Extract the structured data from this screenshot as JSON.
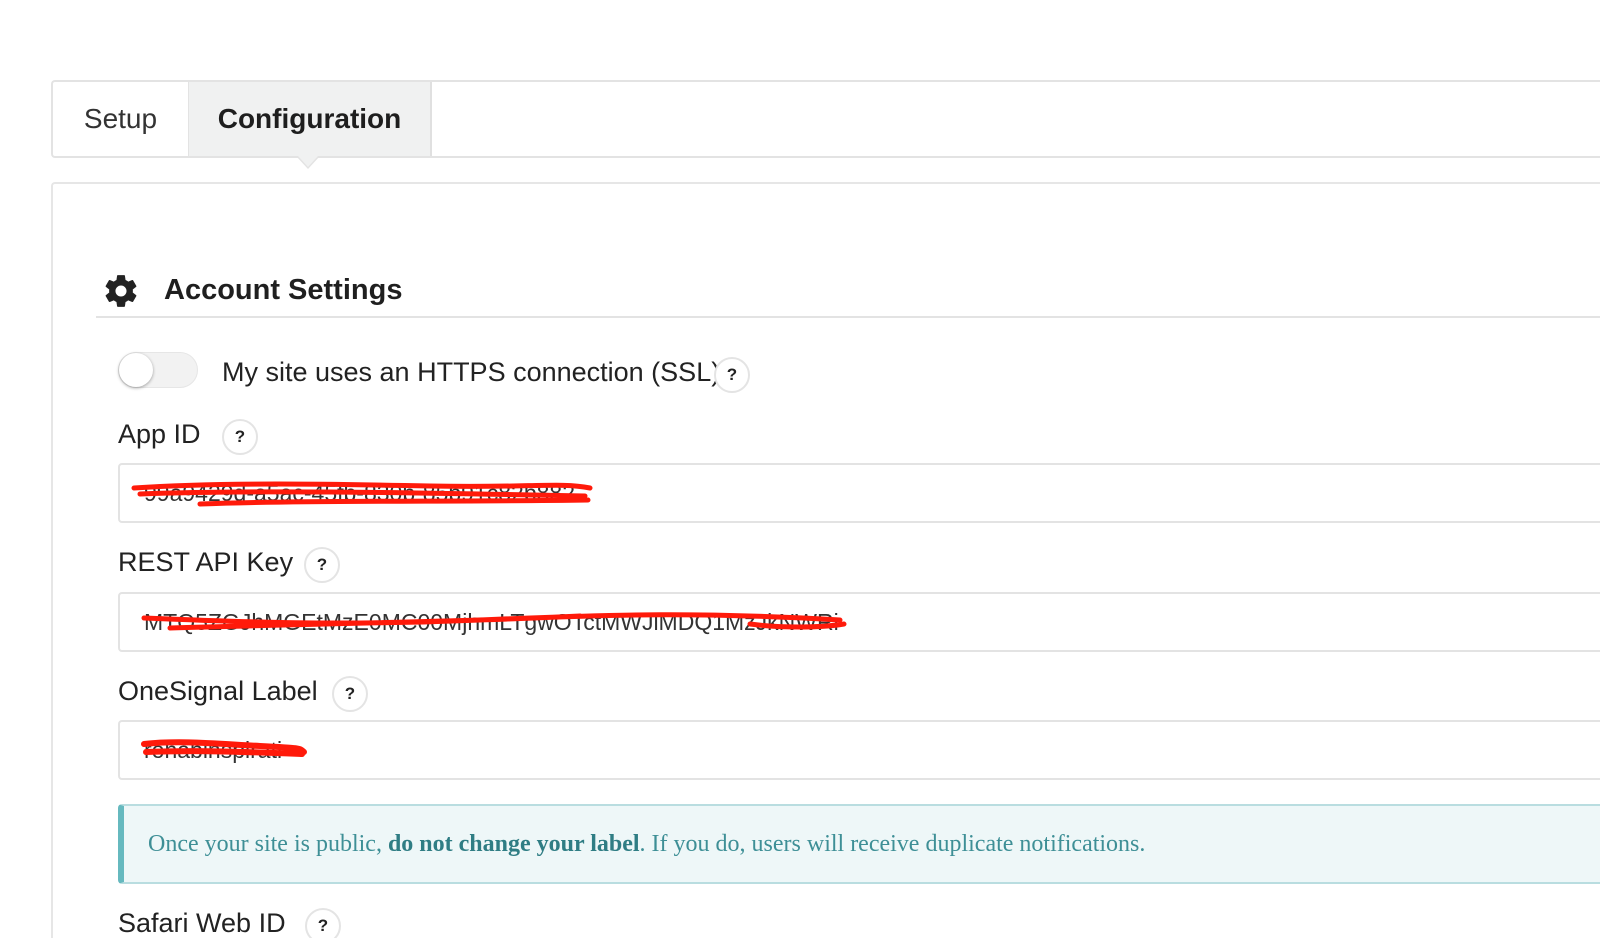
{
  "tabs": [
    {
      "label": "Setup",
      "active": false
    },
    {
      "label": "Configuration",
      "active": true
    }
  ],
  "section": {
    "title": "Account Settings",
    "icon": "gear-icon"
  },
  "https_toggle": {
    "label": "My site uses an HTTPS connection (SSL)",
    "enabled": false,
    "help": "?"
  },
  "fields": {
    "app_id": {
      "label": "App ID",
      "help": "?",
      "value": "99a9429d-a5ac-45fb-830b-85b91c82b882"
    },
    "rest_api_key": {
      "label": "REST API Key",
      "help": "?",
      "value": "MTQ5ZGJhMGEtMzE0MC00MjhmLTgwOTctMWJlMDQ1MzJkNWRi"
    },
    "onesignal_label": {
      "label": "OneSignal Label",
      "help": "?",
      "value": "rohabinspirati"
    }
  },
  "notice": {
    "prefix": "Once your site is public, ",
    "bold": "do not change your label",
    "suffix": ". If you do, users will receive duplicate notifications."
  },
  "next_field": {
    "label": "Safari Web ID",
    "help": "?"
  },
  "colors": {
    "redaction": "#ff1a0a",
    "notice_accent": "#66b9bf",
    "notice_text": "#3e8f96"
  }
}
